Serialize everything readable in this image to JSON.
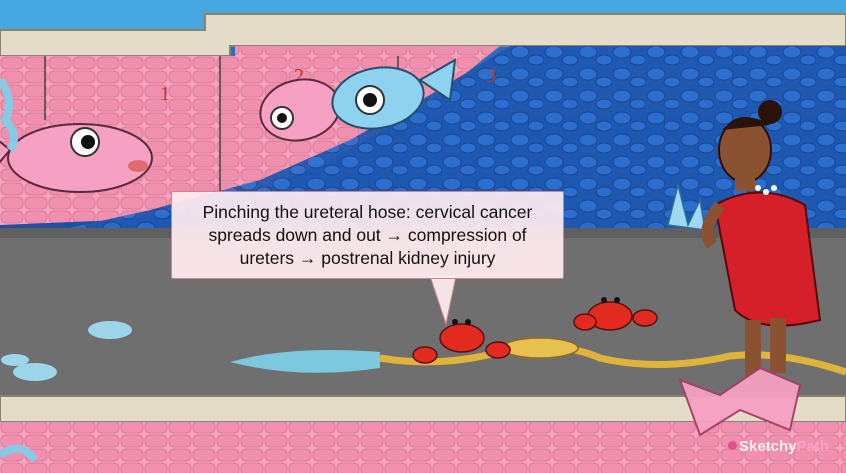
{
  "scene": {
    "panel_numbers": [
      "1",
      "2",
      "3"
    ]
  },
  "tooltip": {
    "text": "Pinching the ureteral hose: cervical cancer spreads down and out → compression of ureters → postrenal kidney injury"
  },
  "watermark": {
    "part1": "Sketchy",
    "part2": "Path"
  },
  "colors": {
    "water": "#2a64b3",
    "floor": "#6f6f6f",
    "brick": "#f4a4bd",
    "ledge": "#e4dcc8",
    "crab": "#e22a1f",
    "hose": "#e0b43a",
    "dress": "#d5202a"
  }
}
